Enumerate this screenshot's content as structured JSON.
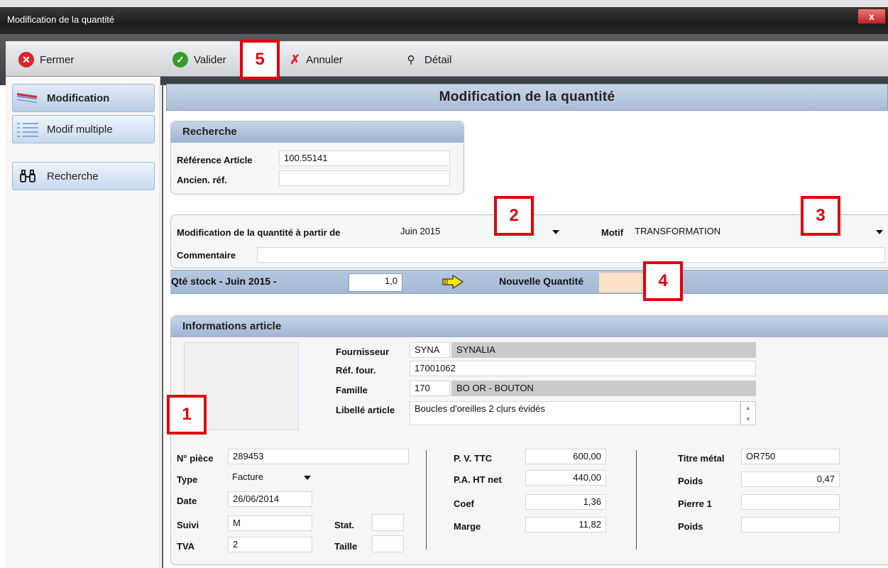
{
  "window": {
    "title": "Modification de la quantité",
    "close_label": "x"
  },
  "toolbar": {
    "fermer": "Fermer",
    "valider": "Valider",
    "annuler": "Annuler",
    "detail": "Détail"
  },
  "sidebar": {
    "items": [
      {
        "label": "Modification",
        "selected": true
      },
      {
        "label": "Modif multiple",
        "selected": false
      },
      {
        "label": "Recherche",
        "selected": false
      }
    ]
  },
  "main": {
    "title": "Modification de la quantité"
  },
  "recherche": {
    "title": "Recherche",
    "ref_article_label": "Référence Article",
    "ref_article_value": "100.55141",
    "ancien_ref_label": "Ancien. réf.",
    "ancien_ref_value": ""
  },
  "modification": {
    "from_label": "Modification de la quantité à partir de",
    "from_value": "Juin 2015",
    "motif_label": "Motif",
    "motif_value": "TRANSFORMATION",
    "commentaire_label": "Commentaire",
    "commentaire_value": "",
    "qte_stock_label": "Qté stock - Juin 2015 -",
    "qte_stock_value": "1,0",
    "nouvelle_qte_label": "Nouvelle Quantité",
    "nouvelle_qte_value": ""
  },
  "info": {
    "title": "Informations article",
    "fournisseur_label": "Fournisseur",
    "fournisseur_code": "SYNA",
    "fournisseur_name": "SYNALIA",
    "ref_four_label": "Réf. four.",
    "ref_four_value": "17001062",
    "famille_label": "Famille",
    "famille_code": "170",
    "famille_name": "BO OR - BOUTON",
    "libelle_label": "Libellé article",
    "libelle_value": "Boucles d'oreilles 2 cļurs évidés",
    "piece_label": "N° pièce",
    "piece_value": "289453",
    "type_label": "Type",
    "type_value": "Facture",
    "date_label": "Date",
    "date_value": "26/06/2014",
    "suivi_label": "Suivi",
    "suivi_value": "M",
    "tva_label": "TVA",
    "tva_value": "2",
    "stat_label": "Stat.",
    "stat_value": "",
    "taille_label": "Taille",
    "taille_value": "",
    "pv_label": "P. V. TTC",
    "pv_value": "600,00",
    "pa_label": "P.A. HT net",
    "pa_value": "440,00",
    "coef_label": "Coef",
    "coef_value": "1,36",
    "marge_label": "Marge",
    "marge_value": "11,82",
    "titre_label": "Titre métal",
    "titre_value": "OR750",
    "poids_label": "Poids",
    "poids_value": "0,47",
    "pierre_label": "Pierre 1",
    "pierre_value": "",
    "poids2_label": "Poids",
    "poids2_value": ""
  },
  "annotations": [
    "1",
    "2",
    "3",
    "4",
    "5"
  ],
  "colors": {
    "annotation_red": "#e0000b",
    "nouvelle_qte_bg": "#fde1c7",
    "header_blue": "#a9bcd6"
  }
}
